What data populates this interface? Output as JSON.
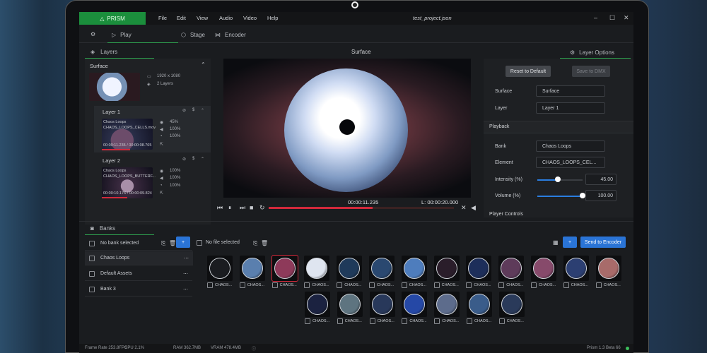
{
  "app": {
    "name": "PRISM",
    "menu": [
      "File",
      "Edit",
      "View",
      "Audio",
      "Video",
      "Help"
    ],
    "file_title": "test_project.json",
    "window_buttons": [
      "–",
      "☐",
      "✕"
    ]
  },
  "tabs": {
    "play": "Play",
    "stage": "Stage",
    "encoder": "Encoder"
  },
  "left": {
    "section_title": "Layers",
    "surface_label": "Surface",
    "surface_res": "1920 x 1080",
    "surface_layers": "2 Layers",
    "layers": [
      {
        "title": "Layer 1",
        "clip": "Chaos Loops",
        "element": "CHAOS_LOOPS_CELLS.mov",
        "timecode": "00:00:11.235 / 00:00:08.765",
        "vals": [
          "45%",
          "100%",
          "100%"
        ]
      },
      {
        "title": "Layer 2",
        "clip": "Chaos Loops",
        "element": "CHAOS_LOOPS_BUTTERF...",
        "timecode": "00:00:10.176 / 00:00:09.824",
        "vals": [
          "100%",
          "100%",
          "100%"
        ]
      }
    ]
  },
  "center": {
    "title": "Surface",
    "time_current": "00:00:11.235",
    "time_length": "L: 00:00:20.000",
    "progress": 0.56
  },
  "right": {
    "title": "Layer Options",
    "reset": "Reset to Default",
    "save": "Save to DMX",
    "surface_label": "Surface",
    "surface_value": "Surface",
    "layer_label": "Layer",
    "layer_value": "Layer 1",
    "playback": "Playback",
    "bank_label": "Bank",
    "bank_value": "Chaos Loops",
    "element_label": "Element",
    "element_value": "CHAOS_LOOPS_CEL...",
    "intensity_label": "Intensity (%)",
    "intensity_value": "45.00",
    "intensity_level": 0.45,
    "volume_label": "Volume (%)",
    "volume_value": "100.00",
    "volume_level": 1.0,
    "player_controls": "Player Controls"
  },
  "banks": {
    "title": "Banks",
    "no_bank": "No bank selected",
    "list": [
      "Chaos Loops",
      "Default Assets",
      "Bank 3"
    ],
    "no_file": "No file selected",
    "send": "Send to Encoder",
    "add": "+",
    "item_label": "CHAOS...",
    "items_row1": 13,
    "items_row2": 7
  },
  "status": {
    "frame": "Frame Rate 253.8FPS",
    "cpu": "CPU 2.1%",
    "ram": "RAM 362.7MB",
    "vram": "VRAM 478.4MB",
    "version": "Prism 1.3 Beta 66"
  }
}
